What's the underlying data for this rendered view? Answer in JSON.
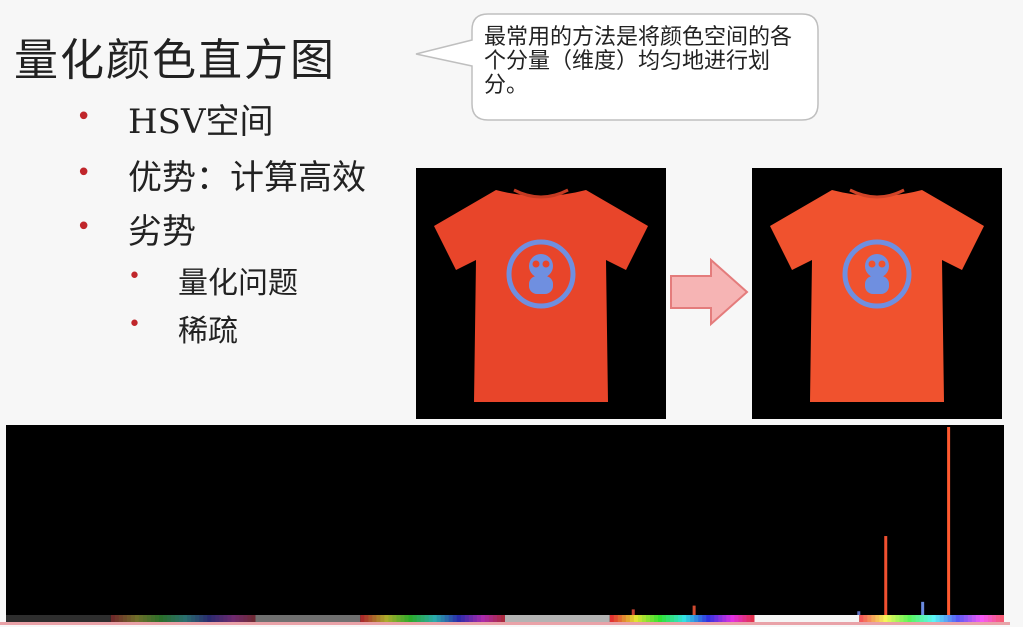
{
  "slide": {
    "title": "量化颜色直方图",
    "bullets": [
      {
        "label": "HSV空间"
      },
      {
        "label": "优势：计算高效"
      },
      {
        "label": "劣势"
      }
    ],
    "sub_bullets": [
      {
        "label": "量化问题"
      },
      {
        "label": "稀疏"
      }
    ]
  },
  "callout": {
    "text": "最常用的方法是将颜色空间的各个分量（维度）均匀地进行划分。"
  },
  "colors": {
    "bullet_dot": "#c0262b",
    "shirt": "#e8452a",
    "logo": "#6f8fe0",
    "arrow_fill": "#f6b4b4",
    "arrow_stroke": "#e47c7c"
  },
  "chart_data": {
    "type": "bar",
    "title": "",
    "xlabel": "",
    "ylabel": "",
    "bins": 4,
    "spikes": [
      {
        "bin_fraction": 0.627,
        "value": 0.03,
        "color": "#c04030"
      },
      {
        "bin_fraction": 0.688,
        "value": 0.05,
        "color": "#d04a30"
      },
      {
        "bin_fraction": 0.853,
        "value": 0.02,
        "color": "#6070c0"
      },
      {
        "bin_fraction": 0.88,
        "value": 0.42,
        "color": "#f05030"
      },
      {
        "bin_fraction": 0.917,
        "value": 0.07,
        "color": "#6a8ae0"
      },
      {
        "bin_fraction": 0.943,
        "value": 1.0,
        "color": "#ff5a30"
      }
    ]
  }
}
